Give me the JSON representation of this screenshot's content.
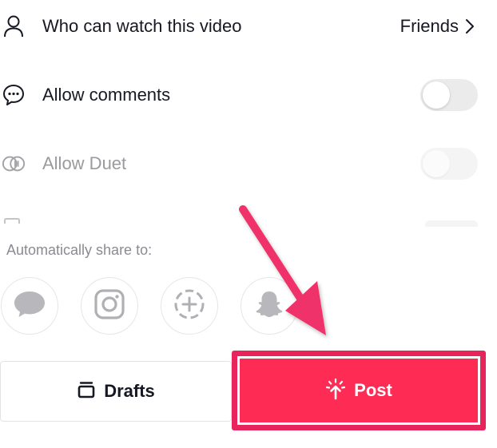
{
  "settings": {
    "who_can_watch": {
      "label": "Who can watch this video",
      "value": "Friends",
      "icon": "person-icon"
    },
    "allow_comments": {
      "label": "Allow comments",
      "enabled": false,
      "icon": "comment-icon"
    },
    "allow_duet": {
      "label": "Allow Duet",
      "enabled": false,
      "icon": "duet-icon"
    }
  },
  "share": {
    "label": "Automatically share to:",
    "targets": [
      {
        "name": "messages",
        "icon": "message-bubble-icon"
      },
      {
        "name": "instagram",
        "icon": "instagram-icon"
      },
      {
        "name": "story",
        "icon": "add-story-icon"
      },
      {
        "name": "snapchat",
        "icon": "snapchat-icon"
      }
    ]
  },
  "actions": {
    "drafts_label": "Drafts",
    "post_label": "Post"
  },
  "colors": {
    "accent": "#fe2c55",
    "annotation_arrow": "#f0306a",
    "text_primary": "#161823",
    "text_muted": "#8a8b91"
  }
}
